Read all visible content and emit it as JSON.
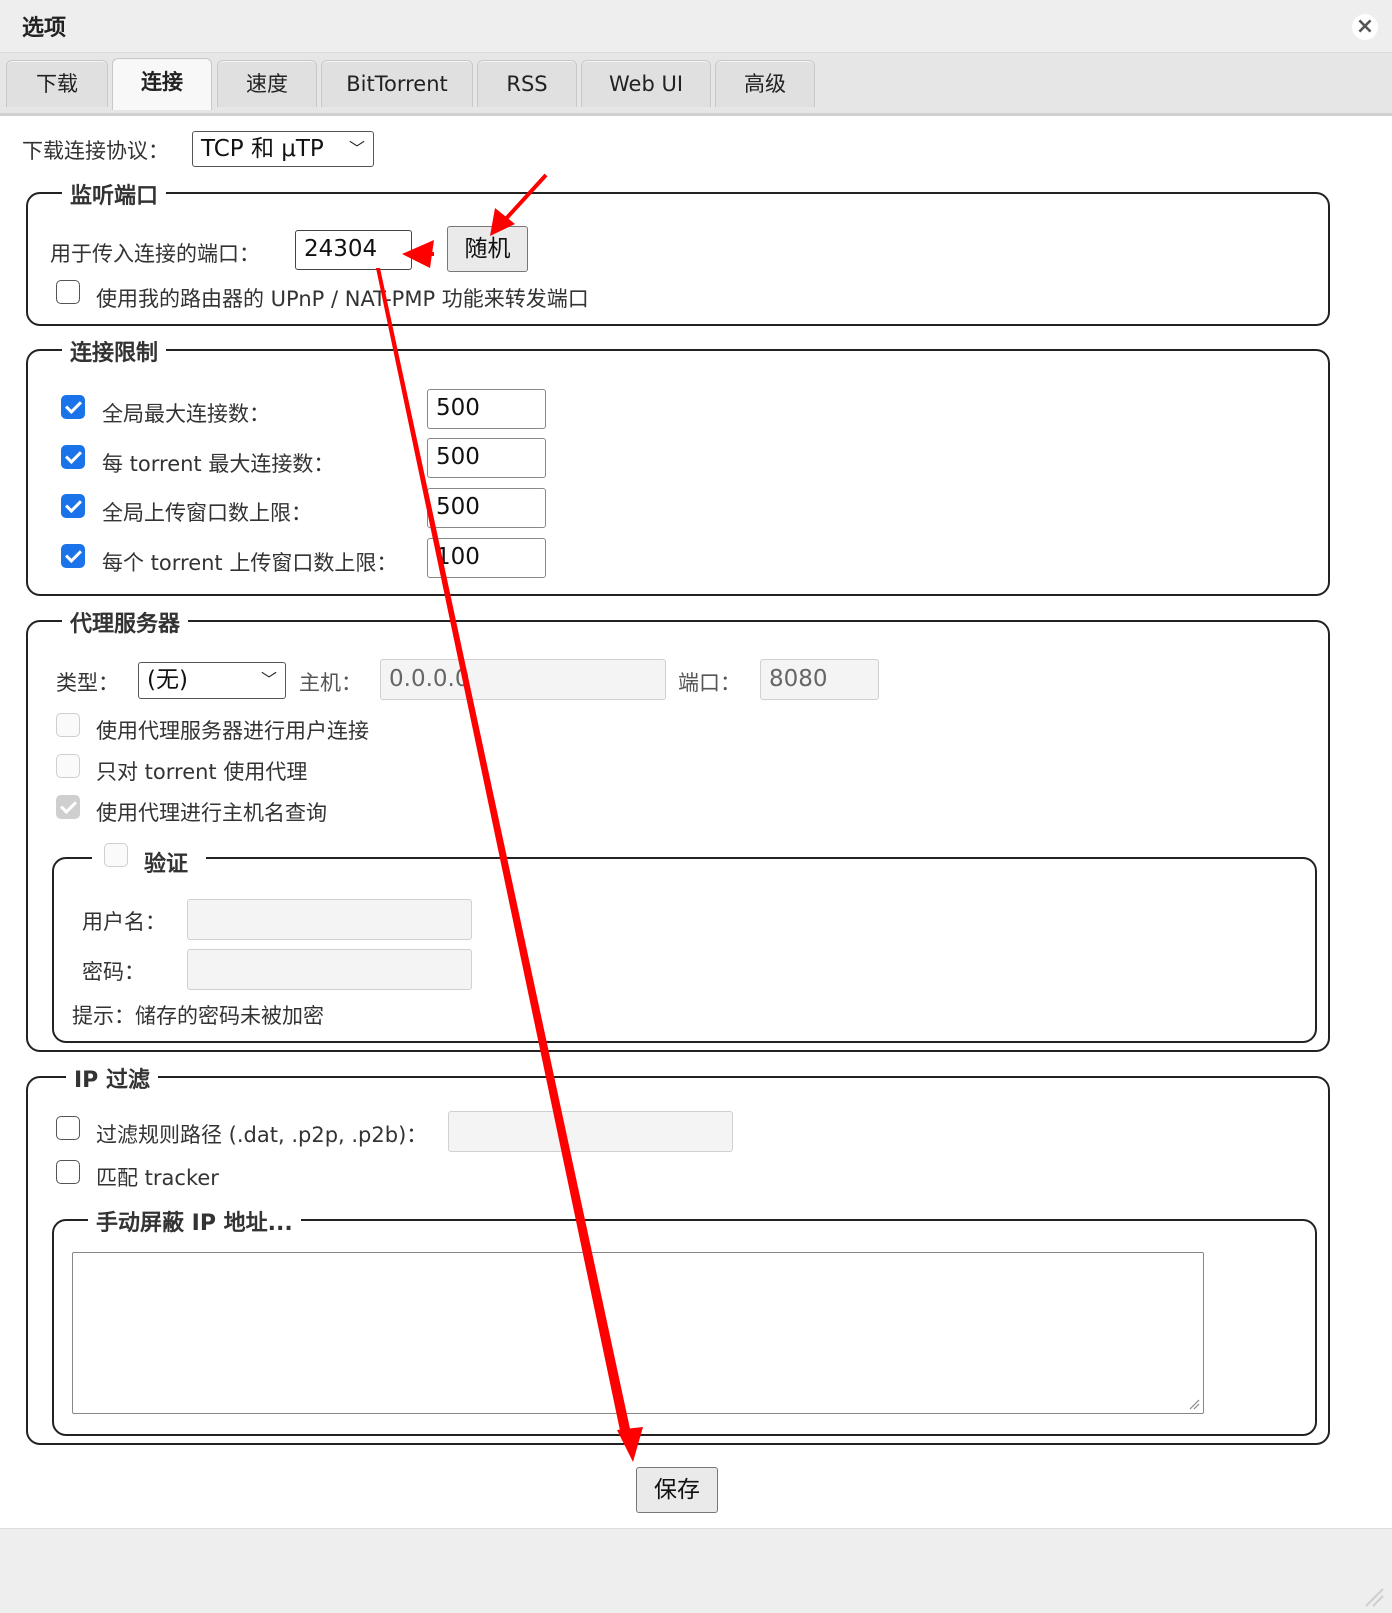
{
  "window": {
    "title": "选项",
    "close_label": "×"
  },
  "tabs": [
    {
      "label": "下载"
    },
    {
      "label": "连接",
      "active": true
    },
    {
      "label": "速度"
    },
    {
      "label": "BitTorrent"
    },
    {
      "label": "RSS"
    },
    {
      "label": "Web UI"
    },
    {
      "label": "高级"
    }
  ],
  "protocol": {
    "label": "下载连接协议：",
    "value": "TCP 和 μTP"
  },
  "listening_port": {
    "legend": "监听端口",
    "port_label": "用于传入连接的端口：",
    "port_value": "24304",
    "random_button": "随机",
    "upnp_label": "使用我的路由器的 UPnP / NAT-PMP 功能来转发端口",
    "upnp_checked": false
  },
  "connection_limits": {
    "legend": "连接限制",
    "rows": [
      {
        "label": "全局最大连接数：",
        "value": "500",
        "checked": true
      },
      {
        "label": "每 torrent 最大连接数：",
        "value": "500",
        "checked": true
      },
      {
        "label": "全局上传窗口数上限：",
        "value": "500",
        "checked": true
      },
      {
        "label": "每个 torrent 上传窗口数上限：",
        "value": "100",
        "checked": true
      }
    ]
  },
  "proxy": {
    "legend": "代理服务器",
    "type_label": "类型：",
    "type_value": "(无)",
    "host_label": "主机：",
    "host_value": "0.0.0.0",
    "port_label": "端口：",
    "port_value": "8080",
    "peer_label": "使用代理服务器进行用户连接",
    "torrent_only_label": "只对 torrent 使用代理",
    "hostname_label": "使用代理进行主机名查询",
    "auth": {
      "legend": "验证",
      "username_label": "用户名：",
      "password_label": "密码：",
      "hint": "提示：储存的密码未被加密"
    }
  },
  "ip_filter": {
    "legend": "IP 过滤",
    "path_label": "过滤规则路径 (.dat, .p2p, .p2b)：",
    "tracker_label": "匹配 tracker",
    "manual_legend": "手动屏蔽 IP 地址..."
  },
  "save_button": "保存",
  "annotation_color": "#ff0000"
}
